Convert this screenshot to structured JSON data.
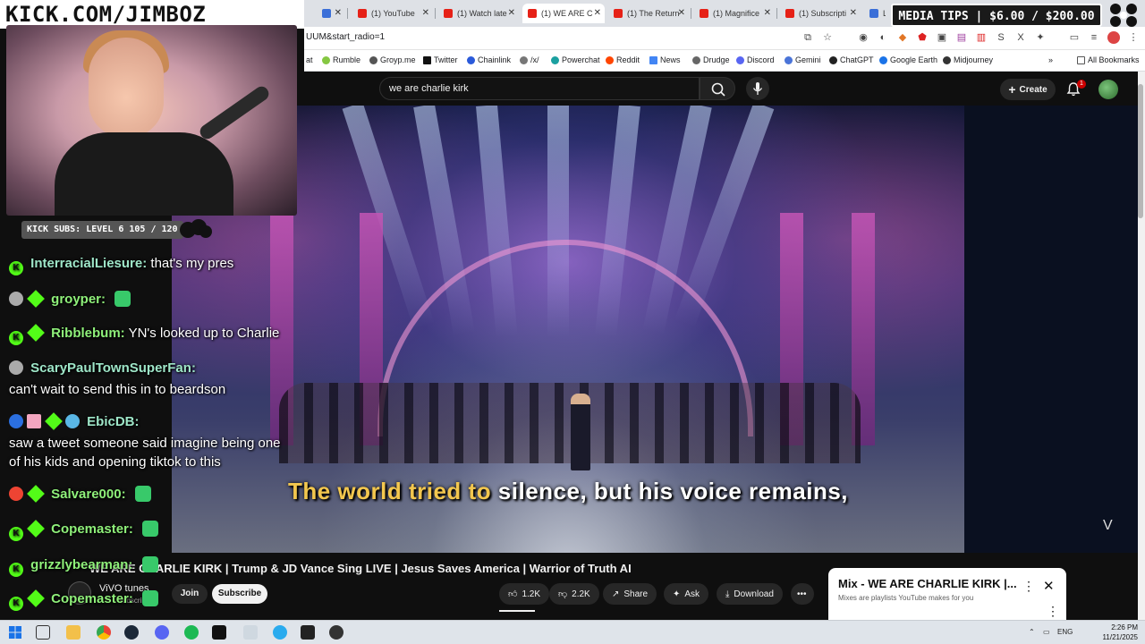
{
  "overlay": {
    "logo_text": "KICK.COM/JIMBOZ",
    "kick_subs": "KICK SUBS: LEVEL 6 105 / 120",
    "media_tips": "MEDIA TIPS | $6.00 / $200.00"
  },
  "tabs": [
    {
      "label": "",
      "type": "doc"
    },
    {
      "label": "(1) YouTube",
      "type": "yt"
    },
    {
      "label": "(1) Watch late",
      "type": "yt"
    },
    {
      "label": "(1) WE ARE C",
      "type": "yt",
      "active": true
    },
    {
      "label": "(1) The Return",
      "type": "yt"
    },
    {
      "label": "(1) Magnifice",
      "type": "yt"
    },
    {
      "label": "(1) Subscripti",
      "type": "yt"
    },
    {
      "label": "L",
      "type": "doc"
    }
  ],
  "address": {
    "url": "UUM&start_radio=1"
  },
  "bookmarks": [
    {
      "label": "at",
      "color": "#888"
    },
    {
      "label": "Rumble",
      "color": "#85c742"
    },
    {
      "label": "Groyp.me",
      "color": "#555"
    },
    {
      "label": "Twitter",
      "color": "#111"
    },
    {
      "label": "Chainlink",
      "color": "#2a5ada"
    },
    {
      "label": "/x/",
      "color": "#777"
    },
    {
      "label": "Powerchat",
      "color": "#1ba0a0"
    },
    {
      "label": "Reddit",
      "color": "#ff4500"
    },
    {
      "label": "News",
      "color": "#4285f4"
    },
    {
      "label": "Drudge",
      "color": "#666"
    },
    {
      "label": "Discord",
      "color": "#5865f2"
    },
    {
      "label": "Gemini",
      "color": "#4a74d8"
    },
    {
      "label": "ChatGPT",
      "color": "#222"
    },
    {
      "label": "Google Earth",
      "color": "#1a73e8"
    },
    {
      "label": "Midjourney",
      "color": "#333"
    },
    {
      "label": "All Bookmarks",
      "color": "#555"
    }
  ],
  "youtube": {
    "search_value": "we are charlie kirk",
    "create_label": "Create",
    "notif_count": "1",
    "subtitle_highlight": "The world tried to",
    "subtitle_rest": " silence, but his voice remains,",
    "chevron": "V",
    "title": "WE ARE CHARLIE KIRK | Trump & JD Vance Sing LIVE | Jesus Saves America | Warrior of Truth AI",
    "channel_name": "ViVO tunes",
    "channel_subs": "subscribers",
    "join_label": "Join",
    "subscribe_label": "Subscribe",
    "likes": "1.2K",
    "dislikes": "2.2K",
    "share_label": "Share",
    "ask_label": "Ask",
    "download_label": "Download"
  },
  "mix": {
    "title": "Mix - WE ARE CHARLIE KIRK |...",
    "subtitle": "Mixes are playlists YouTube makes for you"
  },
  "chat": [
    {
      "user": "InterracialLiesure:",
      "text": "that's my pres",
      "badges": [
        "k"
      ],
      "user_color": "#9ee6c8"
    },
    {
      "user": "groyper:",
      "text": "",
      "badges": [
        "g",
        "d"
      ],
      "user_color": "#8ff07a",
      "emote": true
    },
    {
      "user": "Ribblebum:",
      "text": "YN's looked up to Charlie",
      "badges": [
        "k",
        "d"
      ],
      "user_color": "#8ff07a"
    },
    {
      "user": "ScaryPaulTownSuperFan:",
      "text": "can't wait to send this in to beardson",
      "badges": [
        "g"
      ],
      "user_color": "#9ee6c8"
    },
    {
      "user": "EbicDB:",
      "text": "saw a tweet someone said imagine being one",
      "text2": "of his kids and opening tiktok to this",
      "badges": [
        "b",
        "g",
        "d",
        "b"
      ],
      "user_color": "#9ee6c8"
    },
    {
      "user": "Salvare000:",
      "text": "",
      "badges": [
        "r",
        "d"
      ],
      "user_color": "#8ff07a",
      "emote": true
    },
    {
      "user": "Copemaster:",
      "text": "",
      "badges": [
        "k",
        "d"
      ],
      "user_color": "#8ff07a",
      "emote": true
    },
    {
      "user": "grizzlybearman:",
      "text": "",
      "badges": [
        "k"
      ],
      "user_color": "#8ff07a",
      "emote": true
    },
    {
      "user": "Copemaster:",
      "text": "",
      "badges": [
        "k",
        "d"
      ],
      "user_color": "#8ff07a",
      "emote": true
    }
  ],
  "taskbar": {
    "time": "2:26 PM",
    "date": "11/21/2025",
    "lang": "ENG"
  },
  "colors": {
    "kick_green": "#53fc18",
    "youtube_red": "#cc0000",
    "subtitle_yellow": "#f3c74e"
  }
}
